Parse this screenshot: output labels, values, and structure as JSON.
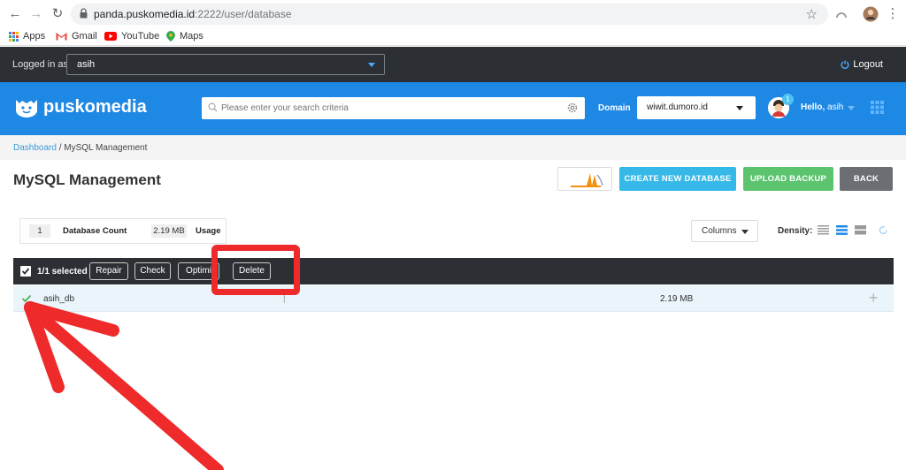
{
  "browser": {
    "url_host": "panda.puskomedia.id",
    "url_path": ":2222/user/database",
    "bookmarks": [
      "Apps",
      "Gmail",
      "YouTube",
      "Maps"
    ]
  },
  "topbar": {
    "logged_in_label": "Logged in as",
    "user": "asih",
    "logout": "Logout"
  },
  "header": {
    "brand": "puskomedia",
    "search_placeholder": "Please enter your search criteria",
    "domain_label": "Domain",
    "domain_value": "wiwit.dumoro.id",
    "notification_count": "1",
    "hello_prefix": "Hello,",
    "hello_user": "asih"
  },
  "breadcrumb": {
    "home": "Dashboard",
    "separator": " / ",
    "current": "MySQL Management"
  },
  "page": {
    "title": "MySQL Management",
    "buttons": {
      "create": "CREATE NEW DATABASE",
      "upload": "UPLOAD BACKUP",
      "back": "BACK"
    }
  },
  "stats": {
    "count_value": "1",
    "count_label": "Database Count",
    "usage_value": "2.19 MB",
    "usage_label": "Usage"
  },
  "toolbar": {
    "columns": "Columns",
    "density": "Density:"
  },
  "actionbar": {
    "selected": "1/1 selected",
    "repair": "Repair",
    "check": "Check",
    "optimize": "Optimi",
    "delete": "Delete"
  },
  "rows": [
    {
      "name": "asih_db",
      "divider": "|",
      "size": "2.19 MB"
    }
  ],
  "colors": {
    "header_blue": "#1e88e5",
    "dark_bar": "#2c3034",
    "create_btn": "#36b9e8",
    "upload_btn": "#5cc46e",
    "back_btn": "#6b6e72",
    "annotation_red": "#ee2a2a"
  }
}
